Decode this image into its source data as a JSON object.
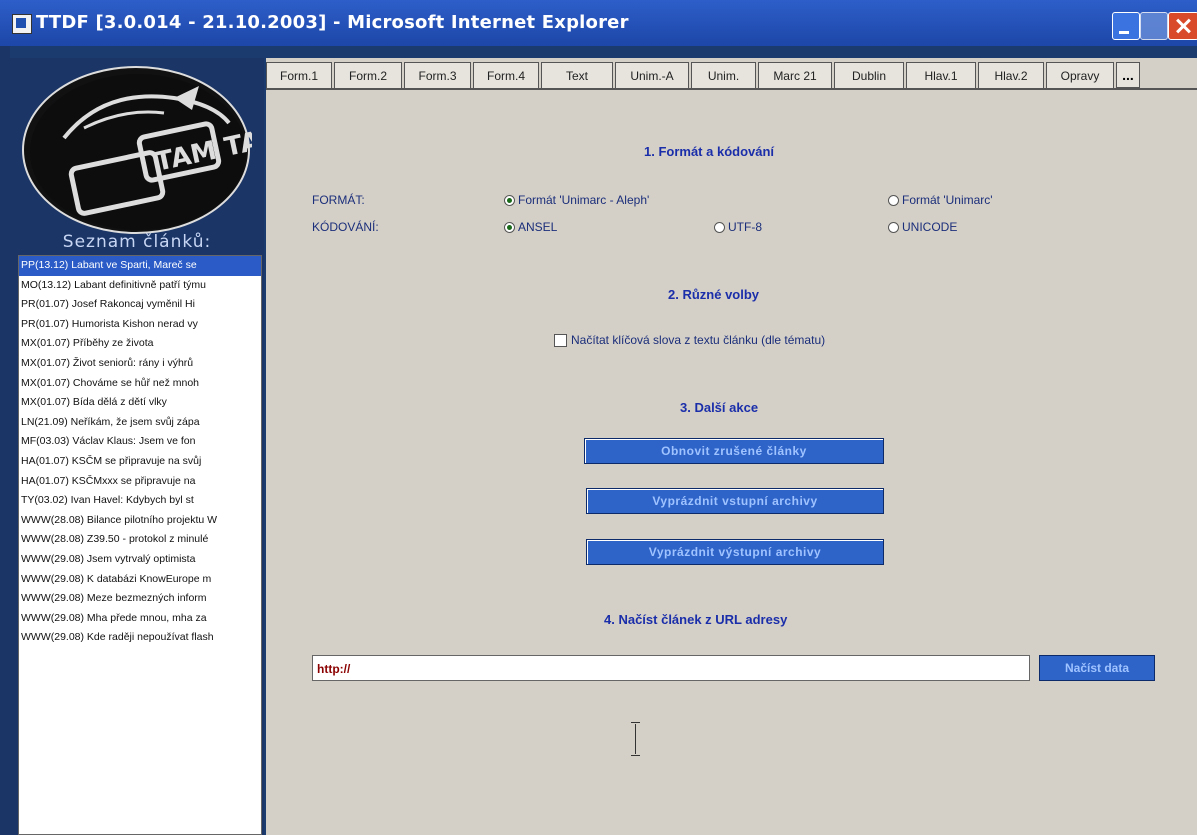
{
  "window": {
    "title": "TTDF [3.0.014 - 21.10.2003] - Microsoft Internet Explorer"
  },
  "sidebar": {
    "logo_text": "TAM TAM",
    "heading": "Seznam článků:",
    "items": [
      {
        "label": "PP(13.12) Labant ve Sparti, Mareč se"
      },
      {
        "label": "MO(13.12) Labant definitivně patří týmu"
      },
      {
        "label": "PR(01.07) Josef Rakoncaj vyměnil Hi"
      },
      {
        "label": "PR(01.07) Humorista Kishon nerad vy"
      },
      {
        "label": "MX(01.07) Příběhy ze života"
      },
      {
        "label": "MX(01.07) Život seniorů: rány i výhrů"
      },
      {
        "label": "MX(01.07) Chováme se hůř než mnoh"
      },
      {
        "label": "MX(01.07) Bída dělá z dětí vlky"
      },
      {
        "label": "LN(21.09) Neříkám, že jsem svůj zápa"
      },
      {
        "label": "MF(03.03) Václav Klaus: Jsem ve fon"
      },
      {
        "label": "HA(01.07) KSČM se připravuje na svůj"
      },
      {
        "label": "HA(01.07) KSČMxxx se připravuje na"
      },
      {
        "label": "TY(03.02) Ivan Havel: Kdybych byl st"
      },
      {
        "label": "WWW(28.08) Bilance pilotního projektu W"
      },
      {
        "label": "WWW(28.08) Z39.50 - protokol z minulé"
      },
      {
        "label": "WWW(29.08) Jsem vytrvalý optimista"
      },
      {
        "label": "WWW(29.08) K databázi KnowEurope m"
      },
      {
        "label": "WWW(29.08) Meze bezmezných inform"
      },
      {
        "label": "WWW(29.08) Mha přede mnou, mha za"
      },
      {
        "label": "WWW(29.08) Kde raději nepoužívat flash"
      }
    ]
  },
  "tabs": [
    {
      "label": "Form.1"
    },
    {
      "label": "Form.2"
    },
    {
      "label": "Form.3"
    },
    {
      "label": "Form.4"
    },
    {
      "label": "Text"
    },
    {
      "label": "Unim.-A"
    },
    {
      "label": "Unim."
    },
    {
      "label": "Marc 21"
    },
    {
      "label": "Dublin"
    },
    {
      "label": "Hlav.1"
    },
    {
      "label": "Hlav.2"
    },
    {
      "label": "Opravy"
    }
  ],
  "tabs_more": "...",
  "section1": {
    "title": "1. Formát a kódování",
    "format_label": "FORMÁT:",
    "format_option_1": "Formát 'Unimarc - Aleph'",
    "format_option_2": "Formát 'Unimarc'",
    "encoding_label": "KÓDOVÁNÍ:",
    "encoding_option_1": "ANSEL",
    "encoding_option_2": "UTF-8",
    "encoding_option_3": "UNICODE"
  },
  "section2": {
    "title": "2. Různé volby",
    "checkbox_label": "Načítat klíčová slova z textu článku (dle tématu)"
  },
  "section3": {
    "title": "3. Další akce",
    "button_restore": "Obnovit zrušené články",
    "button_empty_input": "Vyprázdnit vstupní archivy",
    "button_empty_output": "Vyprázdnit výstupní archivy"
  },
  "section4": {
    "title": "4. Načíst článek z URL adresy",
    "url_value": "http://",
    "load_button": "Načíst data"
  }
}
